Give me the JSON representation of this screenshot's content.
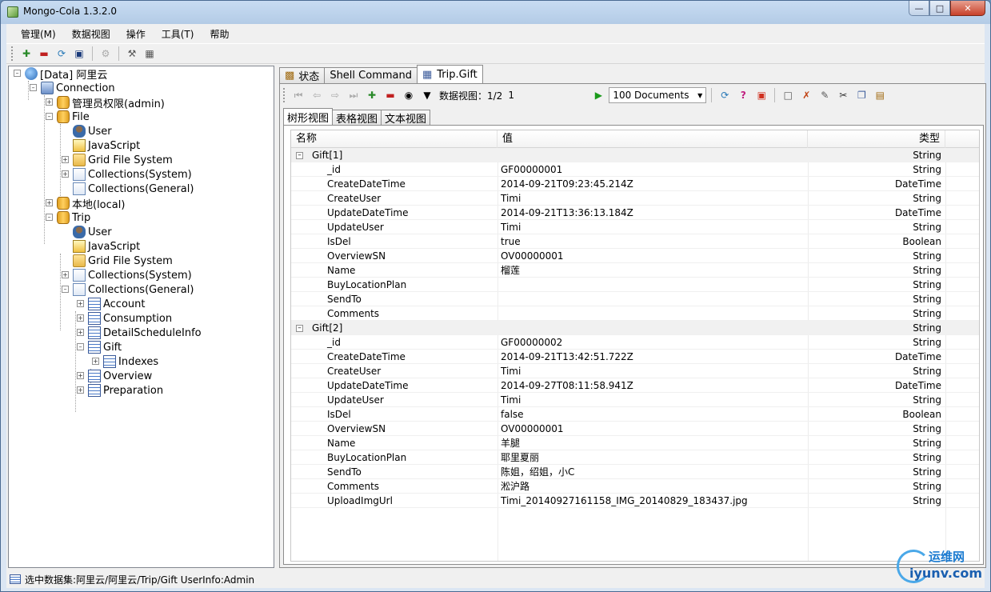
{
  "window": {
    "title": "Mongo-Cola  1.3.2.0"
  },
  "menu": [
    "管理(M)",
    "数据视图",
    "操作",
    "工具(T)",
    "帮助"
  ],
  "tree": {
    "root": "[Data]  阿里云",
    "connection": "Connection",
    "admin": "管理员权限(admin)",
    "file": "File",
    "file_items": [
      "User",
      "JavaScript",
      "Grid File System",
      "Collections(System)",
      "Collections(General)"
    ],
    "local": "本地(local)",
    "trip": "Trip",
    "trip_items": [
      "User",
      "JavaScript",
      "Grid File System",
      "Collections(System)",
      "Collections(General)"
    ],
    "collections": [
      "Account",
      "Consumption",
      "DetailScheduleInfo",
      "Gift",
      "Overview",
      "Preparation"
    ],
    "indexes": "Indexes"
  },
  "tabs": [
    "状态",
    "Shell Command",
    "Trip.Gift"
  ],
  "query_toolbar": {
    "page_label": "数据视图：1/2",
    "page_value": "1",
    "docs_select": "100  Documents"
  },
  "view_tabs": [
    "树形视图",
    "表格视图",
    "文本视图"
  ],
  "grid": {
    "headers": [
      "名称",
      "值",
      "类型"
    ],
    "groups": [
      {
        "name": "Gift[1]",
        "type": "String",
        "rows": [
          [
            "_id",
            "GF00000001",
            "String"
          ],
          [
            "CreateDateTime",
            "2014-09-21T09:23:45.214Z",
            "DateTime"
          ],
          [
            "CreateUser",
            "Timi",
            "String"
          ],
          [
            "UpdateDateTime",
            "2014-09-21T13:36:13.184Z",
            "DateTime"
          ],
          [
            "UpdateUser",
            "Timi",
            "String"
          ],
          [
            "IsDel",
            "true",
            "Boolean"
          ],
          [
            "OverviewSN",
            "OV00000001",
            "String"
          ],
          [
            "Name",
            "榴莲",
            "String"
          ],
          [
            "BuyLocationPlan",
            "",
            "String"
          ],
          [
            "SendTo",
            "",
            "String"
          ],
          [
            "Comments",
            "",
            "String"
          ]
        ]
      },
      {
        "name": "Gift[2]",
        "type": "String",
        "rows": [
          [
            "_id",
            "GF00000002",
            "String"
          ],
          [
            "CreateDateTime",
            "2014-09-21T13:42:51.722Z",
            "DateTime"
          ],
          [
            "CreateUser",
            "Timi",
            "String"
          ],
          [
            "UpdateDateTime",
            "2014-09-27T08:11:58.941Z",
            "DateTime"
          ],
          [
            "UpdateUser",
            "Timi",
            "String"
          ],
          [
            "IsDel",
            "false",
            "Boolean"
          ],
          [
            "OverviewSN",
            "OV00000001",
            "String"
          ],
          [
            "Name",
            "羊腿",
            "String"
          ],
          [
            "BuyLocationPlan",
            "耶里夏丽",
            "String"
          ],
          [
            "SendTo",
            "陈姐，绍姐，小C",
            "String"
          ],
          [
            "Comments",
            "淞沪路",
            "String"
          ],
          [
            "UploadImgUrl",
            "Timi_20140927161158_IMG_20140829_183437.jpg",
            "String"
          ]
        ]
      }
    ]
  },
  "status": {
    "text": "选中数据集:阿里云/阿里云/Trip/Gift  UserInfo:Admin"
  },
  "watermark": {
    "top": "运维网",
    "bottom": "iyunv.com"
  }
}
